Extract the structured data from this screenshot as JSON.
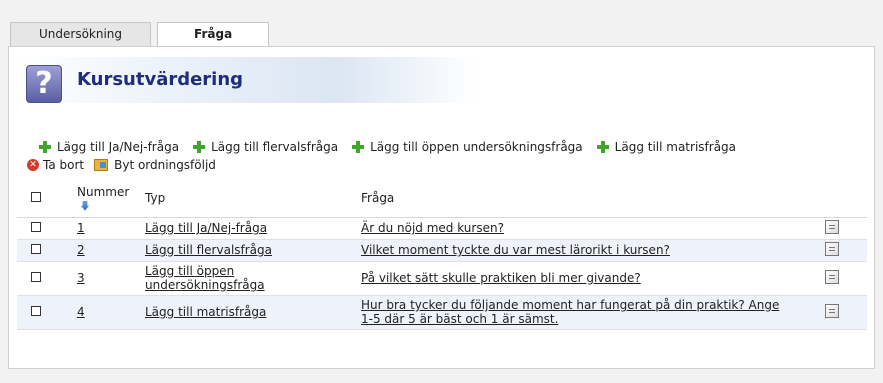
{
  "tabs": [
    {
      "label": "Undersökning",
      "active": false
    },
    {
      "label": "Fråga",
      "active": true
    }
  ],
  "title": "Kursutvärdering",
  "toolbar": {
    "add_yesno": "Lägg till Ja/Nej-fråga",
    "add_multi": "Lägg till flervalsfråga",
    "add_open": "Lägg till öppen undersökningsfråga",
    "add_matrix": "Lägg till matrisfråga",
    "delete": "Ta bort",
    "reorder": "Byt ordningsföljd"
  },
  "table": {
    "headers": {
      "number": "Nummer",
      "type": "Typ",
      "question": "Fråga"
    },
    "rows": [
      {
        "number": "1",
        "type": "Lägg till Ja/Nej-fråga",
        "question": "Är du nöjd med kursen?"
      },
      {
        "number": "2",
        "type": "Lägg till flervalsfråga",
        "question": "Vilket moment tyckte du var mest lärorikt i kursen?"
      },
      {
        "number": "3",
        "type": "Lägg till öppen undersökningsfråga",
        "question": "På vilket sätt skulle praktiken bli mer givande?"
      },
      {
        "number": "4",
        "type": "Lägg till matrisfråga",
        "question": "Hur bra tycker du följande moment har fungerat på din praktik? Ange 1-5 där 5 är bäst och 1 är sämst."
      }
    ]
  },
  "colors": {
    "title": "#1f2e7a",
    "row_alt": "#eef3fb",
    "plus": "#3fa62b",
    "delete": "#d43a2b"
  }
}
